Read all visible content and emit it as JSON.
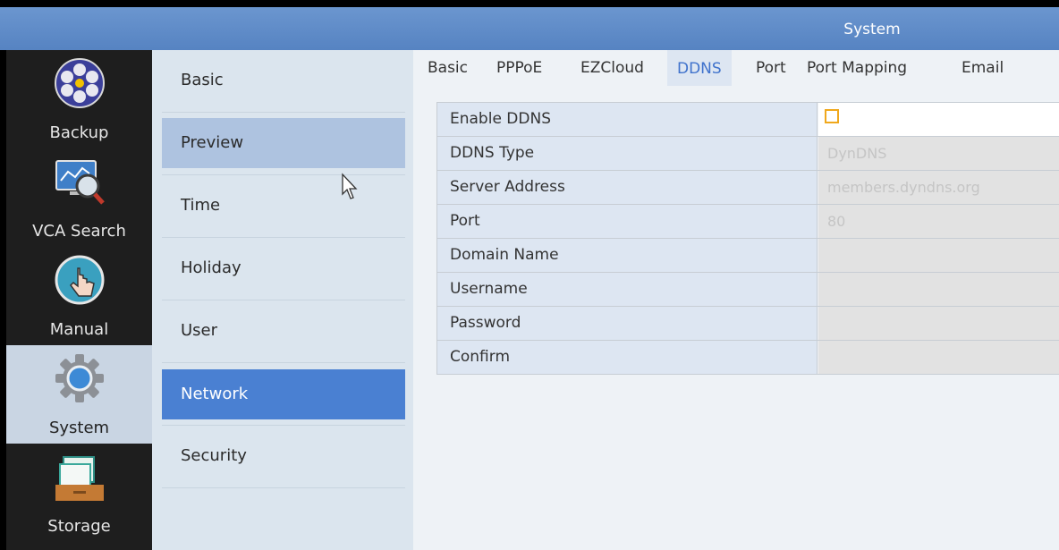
{
  "header": {
    "title": "System"
  },
  "left_nav": {
    "items": [
      {
        "label": "Backup",
        "icon": "film-reel-icon",
        "active": false
      },
      {
        "label": "VCA Search",
        "icon": "monitor-magnifier-icon",
        "active": false
      },
      {
        "label": "Manual",
        "icon": "hand-touch-icon",
        "active": false
      },
      {
        "label": "System",
        "icon": "gear-icon",
        "active": true
      },
      {
        "label": "Storage",
        "icon": "storage-folder-icon",
        "active": false
      }
    ]
  },
  "submenu": {
    "items": [
      "Basic",
      "Preview",
      "Time",
      "Holiday",
      "User",
      "Network",
      "Security"
    ],
    "hovered": "Preview",
    "selected": "Network"
  },
  "tabs": {
    "items": [
      "Basic",
      "PPPoE",
      "EZCloud",
      "DDNS",
      "Port",
      "Port Mapping",
      "Email"
    ],
    "active": "DDNS"
  },
  "ddns_form": {
    "enable_ddns": {
      "label": "Enable DDNS",
      "checked": false
    },
    "ddns_type": {
      "label": "DDNS Type",
      "value": "DynDNS"
    },
    "server_address": {
      "label": "Server Address",
      "value": "members.dyndns.org"
    },
    "port": {
      "label": "Port",
      "value": "80"
    },
    "domain_name": {
      "label": "Domain Name",
      "value": ""
    },
    "username": {
      "label": "Username",
      "value": ""
    },
    "password": {
      "label": "Password",
      "value": ""
    },
    "confirm": {
      "label": "Confirm",
      "value": ""
    }
  },
  "colors": {
    "header_blue": "#5f8cc9",
    "selected_blue": "#4a80d2",
    "checkbox_orange": "#f0a81c"
  }
}
